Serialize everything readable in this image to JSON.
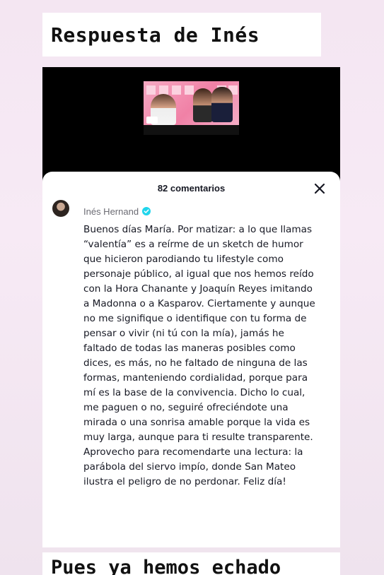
{
  "story": {
    "title_caption": "Respuesta de Inés",
    "bottom_caption": "Pues ya hemos echado"
  },
  "comments_panel": {
    "count_label": "82 comentarios",
    "close_icon": "close-icon"
  },
  "comment": {
    "username": "Inés Hernand",
    "verified_icon": "verified-badge-icon",
    "text": "Buenos días María. Por matizar: a lo que llamas “valentía” es a reírme de un sketch de humor que hicieron parodiando tu lifestyle como personaje público, al igual que nos hemos reído con la Hora Chanante y Joaquín Reyes imitando a Madonna o a Kasparov. Ciertamente y aunque no me signifique o identifique con tu forma de pensar o vivir (ni tú con la mía), jamás he faltado de todas las maneras posibles como dices, es más, no he faltado de ninguna de las formas, manteniendo cordialidad, porque para mí es la base de la convivencia. Dicho lo cual, me paguen o no, seguiré ofreciéndote una mirada o una sonrisa amable porque la vida es muy larga, aunque para ti resulte transparente. Aprovecho para recomendarte una lectura: la parábola del siervo impío, donde San Mateo ilustra el peligro de no perdonar. Feliz día!"
  },
  "colors": {
    "verified": "#20d5ec",
    "background": "#f6e9f4"
  }
}
